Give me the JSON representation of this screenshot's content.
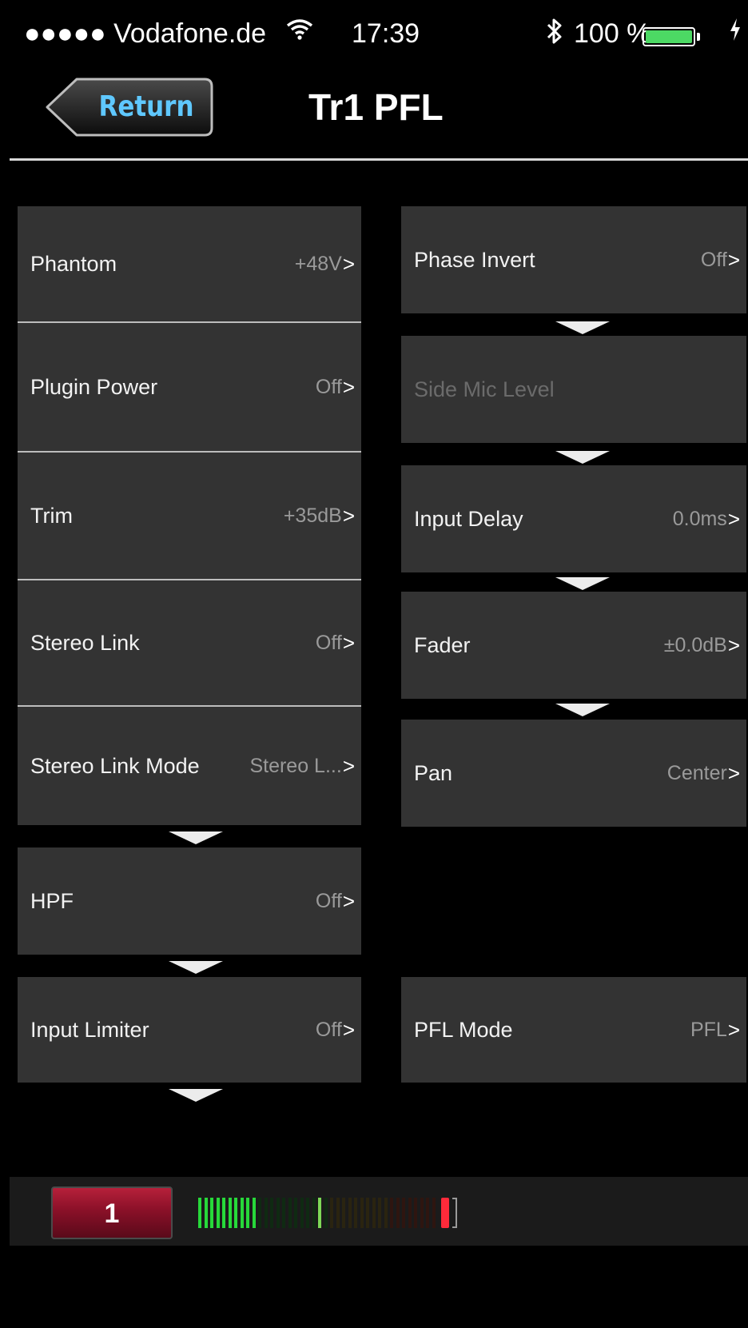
{
  "status_bar": {
    "carrier": "●●●●● Vodafone.de",
    "wifi_icon": "wifi-icon",
    "time": "17:39",
    "bluetooth_icon": "bluetooth-icon",
    "battery_percent": "100 %",
    "battery_color": "#4cd964",
    "charging_icon": "charging-bolt-icon"
  },
  "nav": {
    "back_label": "Return",
    "back_label_color": "#5fc8ff",
    "title": "Tr1 PFL"
  },
  "left_column": [
    {
      "label": "Phantom",
      "value": "+48V"
    },
    {
      "label": "Plugin Power",
      "value": "Off"
    },
    {
      "label": "Trim",
      "value": "+35dB"
    },
    {
      "label": "Stereo Link",
      "value": "Off"
    },
    {
      "label": "Stereo Link Mode",
      "value": "Stereo L..."
    },
    {
      "label": "HPF",
      "value": "Off"
    },
    {
      "label": "Input Limiter",
      "value": "Off"
    }
  ],
  "right_column": [
    {
      "label": "Phase Invert",
      "value": "Off"
    },
    {
      "label": "Side Mic Level",
      "value": "",
      "disabled": true
    },
    {
      "label": "Input Delay",
      "value": "0.0ms"
    },
    {
      "label": "Fader",
      "value": "±0.0dB"
    },
    {
      "label": "Pan",
      "value": "Center"
    },
    {
      "label": "PFL Mode",
      "value": "PFL"
    }
  ],
  "chevron": ">",
  "meter": {
    "channel_label": "1",
    "channel_color": "#b6203a",
    "lit_segments": 10,
    "peak_segment": 20,
    "total_segments": 40,
    "green_color": "#27d93a",
    "peak_color": "#7ed957",
    "clip_color": "#ff2a3a"
  }
}
